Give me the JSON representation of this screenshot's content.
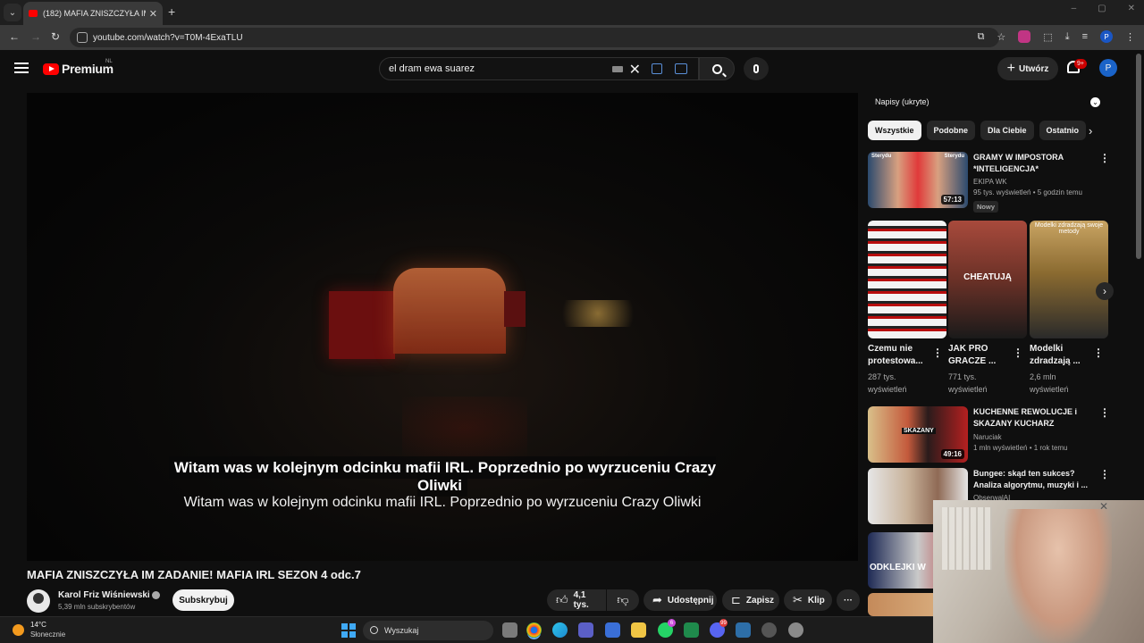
{
  "browser": {
    "tab_title": "(182) MAFIA ZNISZCZYŁA IM ZADANIE",
    "tab_close": "✕",
    "new_tab": "+",
    "url": "youtube.com/watch?v=T0M-4ExaTLU",
    "window_controls": [
      "–",
      "▢",
      "✕"
    ]
  },
  "header": {
    "logo_text": "Premium",
    "region": "NL",
    "search_value": "el dram ewa suarez",
    "create_label": "Utwórz",
    "notif_count": "9+",
    "avatar_letter": "P"
  },
  "player": {
    "caption_burned": "Witam was w kolejnym odcinku mafii IRL. Poprzednio po wyrzuceniu Crazy Oliwki",
    "caption_live": "Witam was w kolejnym odcinku mafii IRL. Poprzednio po wyrzuceniu Crazy Oliwki"
  },
  "video": {
    "title": "MAFIA ZNISZCZYŁA IM ZADANIE! MAFIA IRL SEZON 4 odc.7",
    "channel_name": "Karol Friz Wiśniewski",
    "channel_subs": "5,39 mln subskrybentów",
    "subscribe_label": "Subskrybuj",
    "likes": "4,1 tys.",
    "share_label": "Udostępnij",
    "save_label": "Zapisz",
    "clip_label": "Klip",
    "more_label": "···"
  },
  "sidebar": {
    "captions_panel": "Napisy (ukryte)",
    "chips": [
      "Wszystkie",
      "Podobne",
      "Dla Ciebie",
      "Ostatnio"
    ],
    "rec1": {
      "title_line1": "GRAMY W IMPOSTORA",
      "title_line2": "*INTELIGENCJA*",
      "channel": "EKIPA WK",
      "meta": "95 tys. wyświetleń • 5 godzin temu",
      "badge": "Nowy",
      "duration": "57:13",
      "thumb_label1": "Sterydu",
      "thumb_label2": "Sterydu"
    },
    "shorts": [
      {
        "title_line1": "Czemu nie",
        "title_line2": "protestowa...",
        "meta_line1": "287 tys.",
        "meta_line2": "wyświetleń"
      },
      {
        "title_line1": "JAK PRO",
        "title_line2": "GRACZE ...",
        "meta_line1": "771 tys.",
        "meta_line2": "wyświetleń",
        "overlay": "CHEATUJĄ"
      },
      {
        "title_line1": "Modelki",
        "title_line2": "zdradzają ...",
        "meta_line1": "2,6 mln",
        "meta_line2": "wyświetleń",
        "overlay": "Modelki zdradzają swoje metody"
      }
    ],
    "rec2": {
      "title_line1": "KUCHENNE REWOLUCJE i",
      "title_line2": "SKAZANY KUCHARZ",
      "channel": "Naruciak",
      "meta": "1 mln wyświetleń • 1 rok temu",
      "duration": "49:16",
      "thumb_label": "SKAZANY"
    },
    "rec3": {
      "title_line1": "Bungee: skąd ten sukces?",
      "title_line2": "Analiza algorytmu, muzyki i ...",
      "channel": "ObserwalAI"
    },
    "rec4": {
      "thumb_label": "ODKLEJKI W"
    }
  },
  "taskbar": {
    "temp": "14°C",
    "condition": "Słonecznie",
    "search_label": "Wyszukaj",
    "badges": [
      "6",
      "99"
    ]
  }
}
